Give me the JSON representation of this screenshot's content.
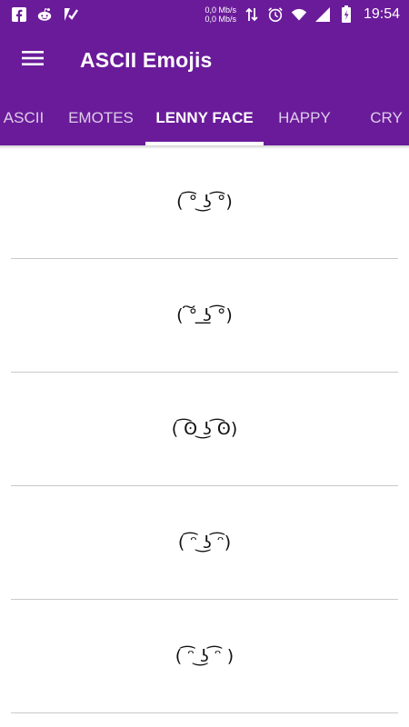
{
  "status_bar": {
    "net_up": "0,0 Mb/s",
    "net_down": "0,0 Mb/s",
    "time": "19:54",
    "icons": [
      "facebook-icon",
      "reddit-icon",
      "vpn-check-icon",
      "data-arrows-icon",
      "alarm-icon",
      "wifi-icon",
      "signal-icon",
      "battery-icon"
    ]
  },
  "app_bar": {
    "title": "ASCII Emojis",
    "menu_icon": "hamburger-menu-icon"
  },
  "tabs": [
    {
      "label": "ASCII"
    },
    {
      "label": "EMOTES"
    },
    {
      "label": "LENNY FACE",
      "active": true
    },
    {
      "label": "HAPPY"
    },
    {
      "label": "CRY"
    }
  ],
  "emojis": [
    "( ͡° ͜ʖ ͡°)",
    "( ͠° ͟ʖ ͡°)",
    "( ͡ʘ ͜ʖ ͡ʘ)",
    "( ͡ᵔ ͜ʖ ͡ᵔ)",
    "( ͡ᵔ ͜ʖ ͡ᵔ )"
  ],
  "colors": {
    "primary": "#6a1b9a",
    "divider": "#c9c9c9",
    "text": "#111111"
  }
}
